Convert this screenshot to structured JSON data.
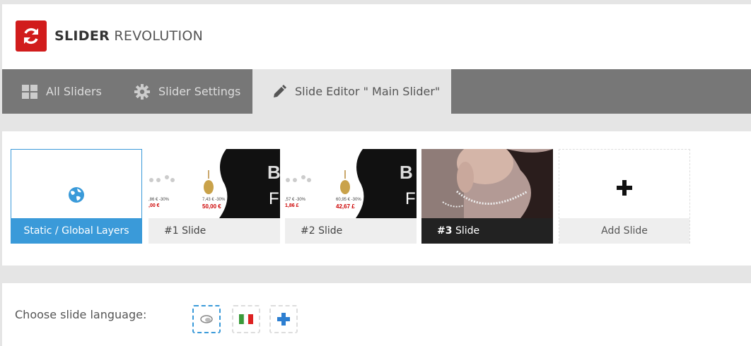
{
  "brand": {
    "name_bold": "SLIDER",
    "name_light": "REVOLUTION"
  },
  "tabs": [
    {
      "label": "All Sliders",
      "icon": "grid-icon"
    },
    {
      "label": "Slider Settings",
      "icon": "gear-icon"
    },
    {
      "label": "Slide Editor \" Main Slider\"",
      "icon": "pencil-icon",
      "active": true
    }
  ],
  "slides": {
    "static": {
      "label": "Static / Global Layers",
      "icon": "globe-icon"
    },
    "items": [
      {
        "num": "#1",
        "label": "Slide",
        "thumb_text": {
          "p1": ",86 € -30%",
          "p2": "7,43 € -30%",
          "s1": ",00 €",
          "s2": "50,00 €",
          "big": "B",
          "big2": "F"
        }
      },
      {
        "num": "#2",
        "label": "Slide",
        "thumb_text": {
          "p1": ",57 € -30%",
          "p2": "60,95 € -30%",
          "s1": "1,86 £",
          "s2": "42,67 £",
          "big": "B",
          "big2": "F"
        }
      },
      {
        "num": "#3",
        "label": "Slide",
        "active": true
      }
    ],
    "add": {
      "label": "Add Slide",
      "icon": "plus-icon"
    }
  },
  "language": {
    "label": "Choose slide language:",
    "options": [
      {
        "icon": "default-language-icon",
        "selected": true
      },
      {
        "icon": "italy-flag-icon",
        "selected": false
      },
      {
        "icon": "add-language-icon",
        "selected": false
      }
    ]
  },
  "colors": {
    "brand_red": "#d11c1c",
    "accent_blue": "#3a9ad9",
    "tabbar": "#777777"
  }
}
